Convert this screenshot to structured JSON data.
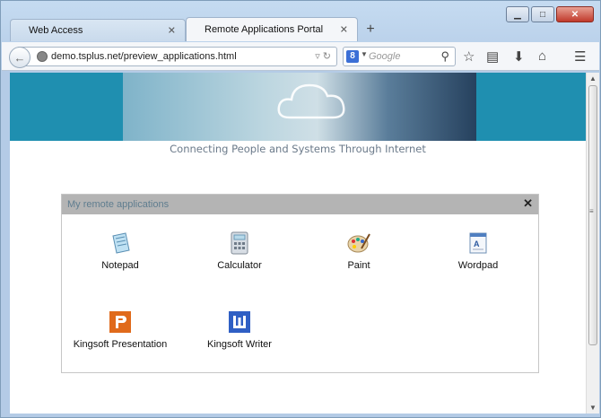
{
  "browser": {
    "tabs": [
      {
        "label": "Web Access",
        "active": false
      },
      {
        "label": "Remote Applications Portal",
        "active": true
      }
    ],
    "new_tab": "+",
    "url": "demo.tsplus.net/preview_applications.html",
    "search_placeholder": "Google",
    "search_engine_letter": "8"
  },
  "page": {
    "tagline": "Connecting People and Systems Through Internet",
    "panel_title": "My remote applications",
    "apps": [
      {
        "label": "Notepad",
        "icon": "notepad-icon"
      },
      {
        "label": "Calculator",
        "icon": "calculator-icon"
      },
      {
        "label": "Paint",
        "icon": "paint-palette-icon"
      },
      {
        "label": "Wordpad",
        "icon": "wordpad-icon"
      },
      {
        "label": "Kingsoft Presentation",
        "icon": "kingsoft-presentation-icon"
      },
      {
        "label": "Kingsoft Writer",
        "icon": "kingsoft-writer-icon"
      }
    ]
  },
  "colors": {
    "banner": "#1f8fb0",
    "panel_header": "#b4b4b4",
    "kingsoft_presentation": "#e06a1b",
    "kingsoft_writer": "#2f5fc4"
  }
}
